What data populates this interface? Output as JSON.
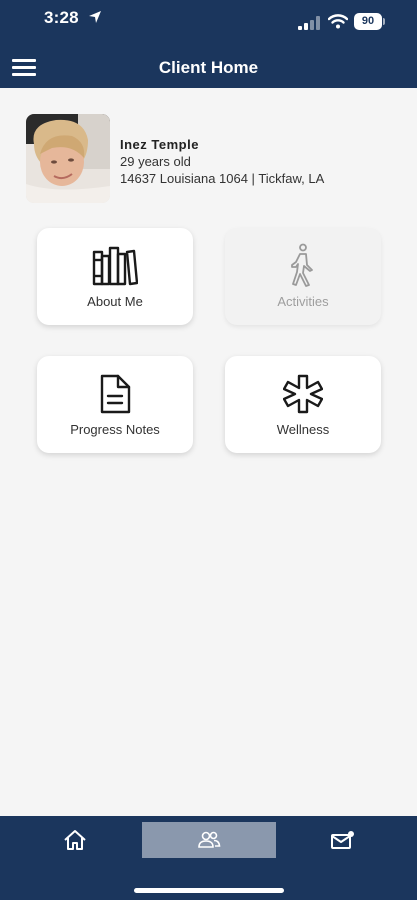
{
  "status_bar": {
    "time": "3:28",
    "battery": "90"
  },
  "header": {
    "title": "Client Home",
    "menu_icon": "menu-icon"
  },
  "client": {
    "name": "Inez Temple",
    "age": "29 years old",
    "address": "14637 Louisiana 1064 | Tickfaw, LA"
  },
  "tiles": [
    {
      "label": "About Me",
      "icon": "books-icon",
      "enabled": true
    },
    {
      "label": "Activities",
      "icon": "walking-person-icon",
      "enabled": false
    },
    {
      "label": "Progress Notes",
      "icon": "document-icon",
      "enabled": true
    },
    {
      "label": "Wellness",
      "icon": "asterisk-icon",
      "enabled": true
    }
  ],
  "bottom_nav": [
    {
      "icon": "home-icon",
      "active": false
    },
    {
      "icon": "people-icon",
      "active": true
    },
    {
      "icon": "mail-icon",
      "active": false
    }
  ],
  "colors": {
    "brand": "#1b365d",
    "active_tab": "#8a98ad",
    "background": "#f5f5f5"
  }
}
